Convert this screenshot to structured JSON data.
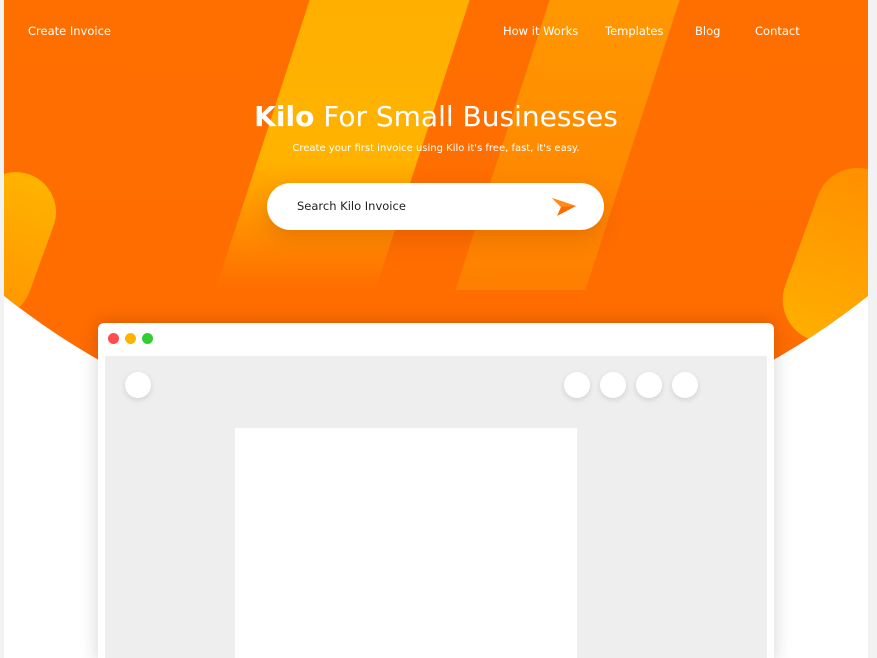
{
  "nav": {
    "brand_link": "Create Invoice",
    "links": [
      "How it Works",
      "Templates",
      "Blog",
      "Contact"
    ]
  },
  "hero": {
    "title_bold": "Kilo",
    "title_rest": "For Small Businesses",
    "subtitle": "Create your first invoice using Kilo it's free, fast, it's easy.",
    "search_placeholder": "Search Kilo Invoice",
    "send_icon": "paper-plane-icon"
  },
  "colors": {
    "hero_orange": "#ff6b00",
    "accent_yellow": "#ffb300",
    "dot_red": "#ff4d4d",
    "dot_yellow": "#ffb300",
    "dot_green": "#33cc33"
  }
}
